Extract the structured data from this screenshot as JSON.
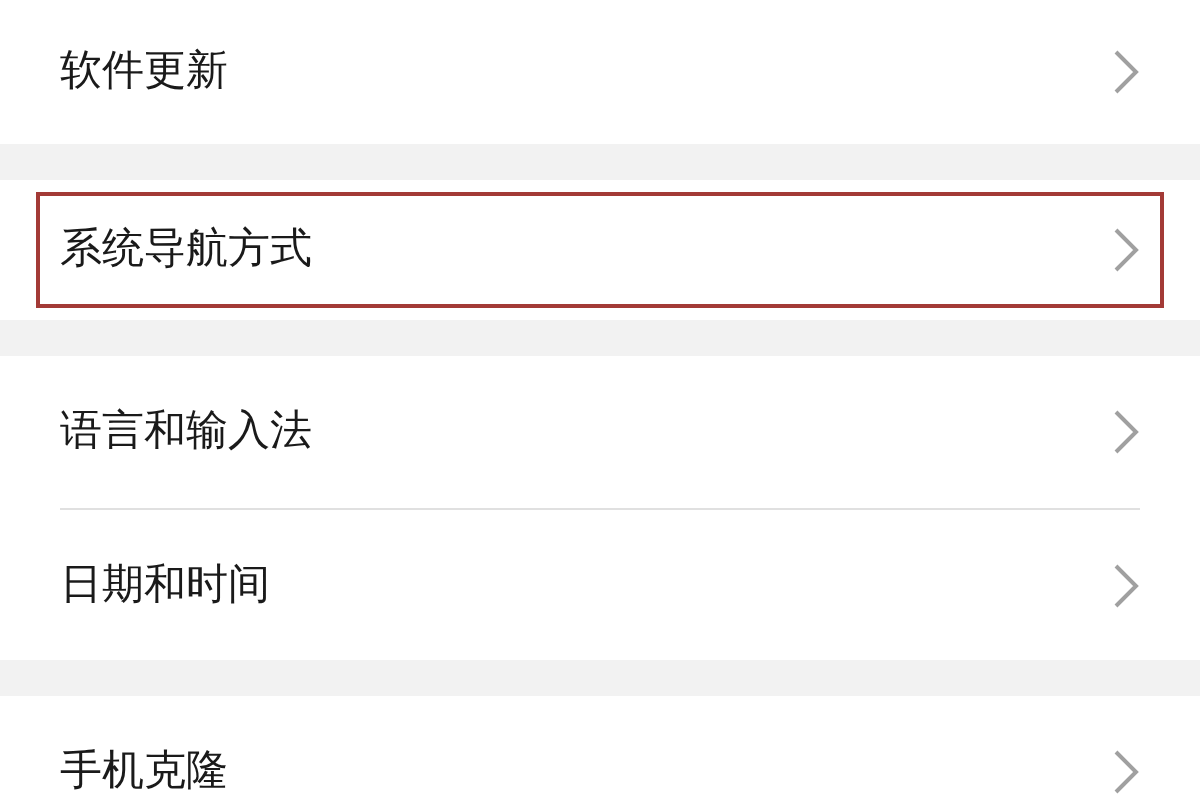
{
  "groups": [
    {
      "items": [
        {
          "label": "软件更新",
          "highlighted": false
        }
      ]
    },
    {
      "items": [
        {
          "label": "系统导航方式",
          "highlighted": true
        }
      ]
    },
    {
      "items": [
        {
          "label": "语言和输入法",
          "highlighted": false
        },
        {
          "label": "日期和时间",
          "highlighted": false
        }
      ]
    },
    {
      "items": [
        {
          "label": "手机克隆",
          "highlighted": false
        }
      ]
    }
  ]
}
